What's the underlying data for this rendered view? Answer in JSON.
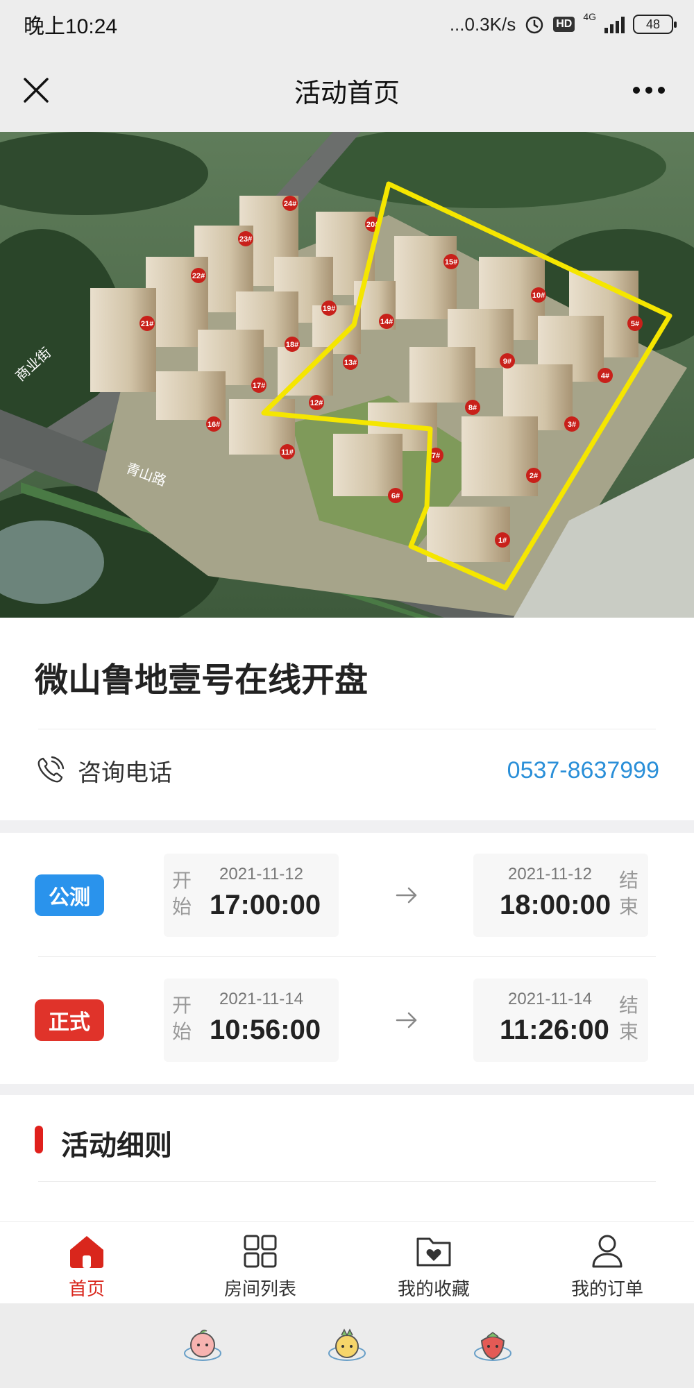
{
  "status_bar": {
    "time": "晚上10:24",
    "network_speed": "...0.3K/s",
    "hd": "HD",
    "network_type": "4G",
    "battery": "48"
  },
  "nav": {
    "title": "活动首页"
  },
  "hero": {
    "building_labels": [
      "24#",
      "20#",
      "23#",
      "22#",
      "21#",
      "19#",
      "15#",
      "10#",
      "5#",
      "14#",
      "18#",
      "13#",
      "9#",
      "4#",
      "17#",
      "12#",
      "8#",
      "3#",
      "16#",
      "11#",
      "7#",
      "2#",
      "6#",
      "1#"
    ],
    "street_labels": [
      "商业街",
      "青山路"
    ]
  },
  "event": {
    "title": "微山鲁地壹号在线开盘",
    "phone_label": "咨询电话",
    "phone_number": "0537-8637999"
  },
  "schedule": [
    {
      "tag": "公测",
      "tag_color": "#2a93ec",
      "start_side": "开始",
      "start_date": "2021-11-12",
      "start_time": "17:00:00",
      "end_date": "2021-11-12",
      "end_time": "18:00:00",
      "end_side": "结束"
    },
    {
      "tag": "正式",
      "tag_color": "#e0332a",
      "start_side": "开始",
      "start_date": "2021-11-14",
      "start_time": "10:56:00",
      "end_date": "2021-11-14",
      "end_time": "11:26:00",
      "end_side": "结束"
    }
  ],
  "rules": {
    "title": "活动细则"
  },
  "tabs": [
    {
      "label": "首页",
      "icon": "home-icon",
      "active": true
    },
    {
      "label": "房间列表",
      "icon": "grid-icon",
      "active": false
    },
    {
      "label": "我的收藏",
      "icon": "favorite-folder-icon",
      "active": false
    },
    {
      "label": "我的订单",
      "icon": "user-icon",
      "active": false
    }
  ],
  "colors": {
    "accent_red": "#d9261c",
    "link_blue": "#2a8fd8",
    "highlight_yellow": "#f5e600"
  }
}
